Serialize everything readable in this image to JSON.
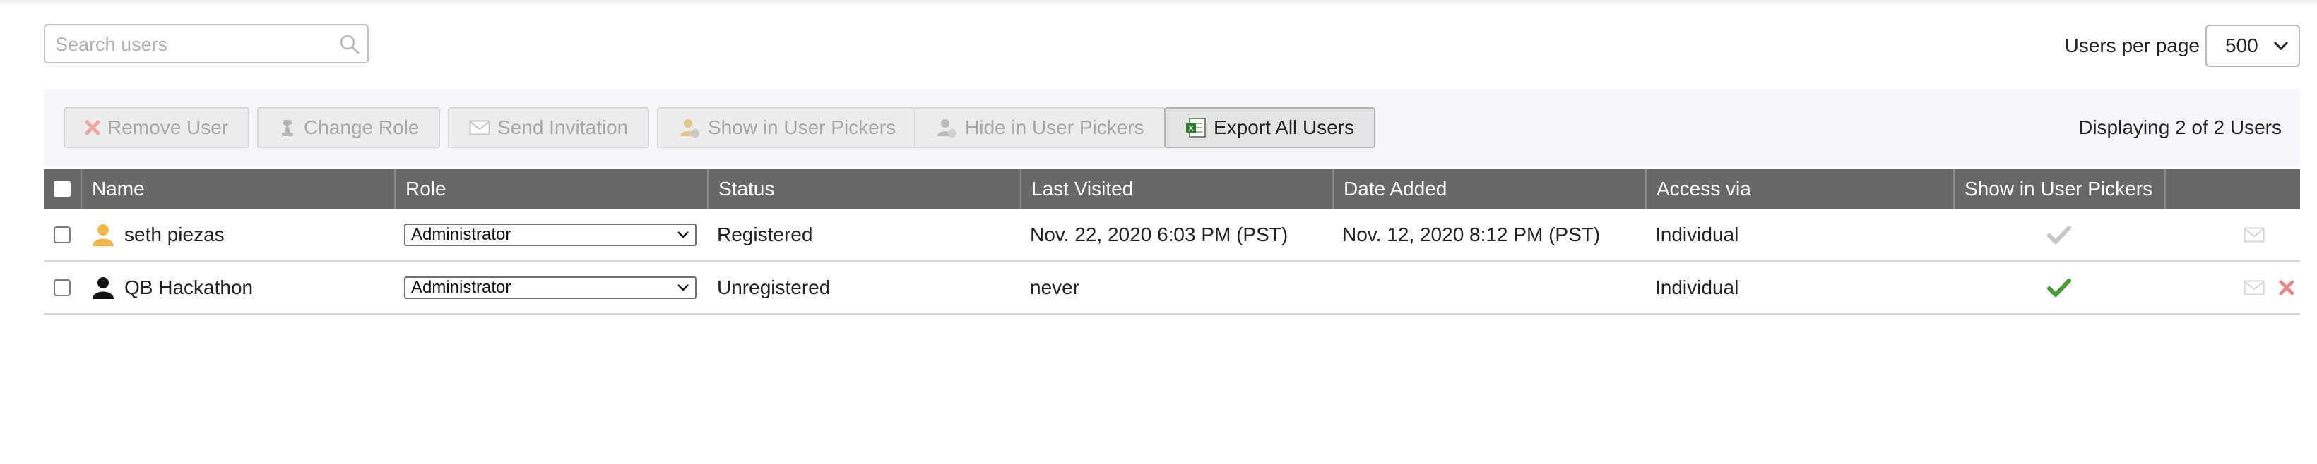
{
  "search": {
    "placeholder": "Search users",
    "value": "",
    "icon": "search-icon"
  },
  "pagination": {
    "label": "Users per page",
    "selected": "500"
  },
  "toolbar": {
    "buttons": [
      {
        "label": "Remove User",
        "icon": "remove-x-icon",
        "enabled": false
      },
      {
        "label": "Change Role",
        "icon": "chess-piece-icon",
        "enabled": false
      },
      {
        "label": "Send Invitation",
        "icon": "envelope-icon",
        "enabled": false
      },
      {
        "label": "Show in User Pickers",
        "icon": "user-show-icon",
        "enabled": false
      },
      {
        "label": "Hide in User Pickers",
        "icon": "user-hide-icon",
        "enabled": false
      },
      {
        "label": "Export All Users",
        "icon": "excel-icon",
        "enabled": true
      }
    ],
    "displaying": "Displaying 2 of 2 Users"
  },
  "table": {
    "columns": [
      "Name",
      "Role",
      "Status",
      "Last Visited",
      "Date Added",
      "Access via",
      "Show in User Pickers"
    ],
    "rows": [
      {
        "name": "seth piezas",
        "avatar": "user-icon-gold",
        "role": "Administrator",
        "status": "Registered",
        "last_visited": "Nov. 22, 2020 6:03 PM (PST)",
        "date_added": "Nov. 12, 2020 8:12 PM (PST)",
        "access_via": "Individual",
        "show_in_pickers": true,
        "show_in_pickers_state": "inactive",
        "actions": [
          "envelope-icon"
        ]
      },
      {
        "name": "QB Hackathon",
        "avatar": "user-icon-black",
        "role": "Administrator",
        "status": "Unregistered",
        "last_visited": "never",
        "date_added": "",
        "access_via": "Individual",
        "show_in_pickers": true,
        "show_in_pickers_state": "active",
        "actions": [
          "envelope-icon",
          "remove-x-icon"
        ]
      }
    ]
  },
  "colors": {
    "header_bg": "#686868",
    "toolbar_bg": "#f4f6fa",
    "check_green": "#4c9a3c",
    "remove_red": "#e38a8a"
  }
}
